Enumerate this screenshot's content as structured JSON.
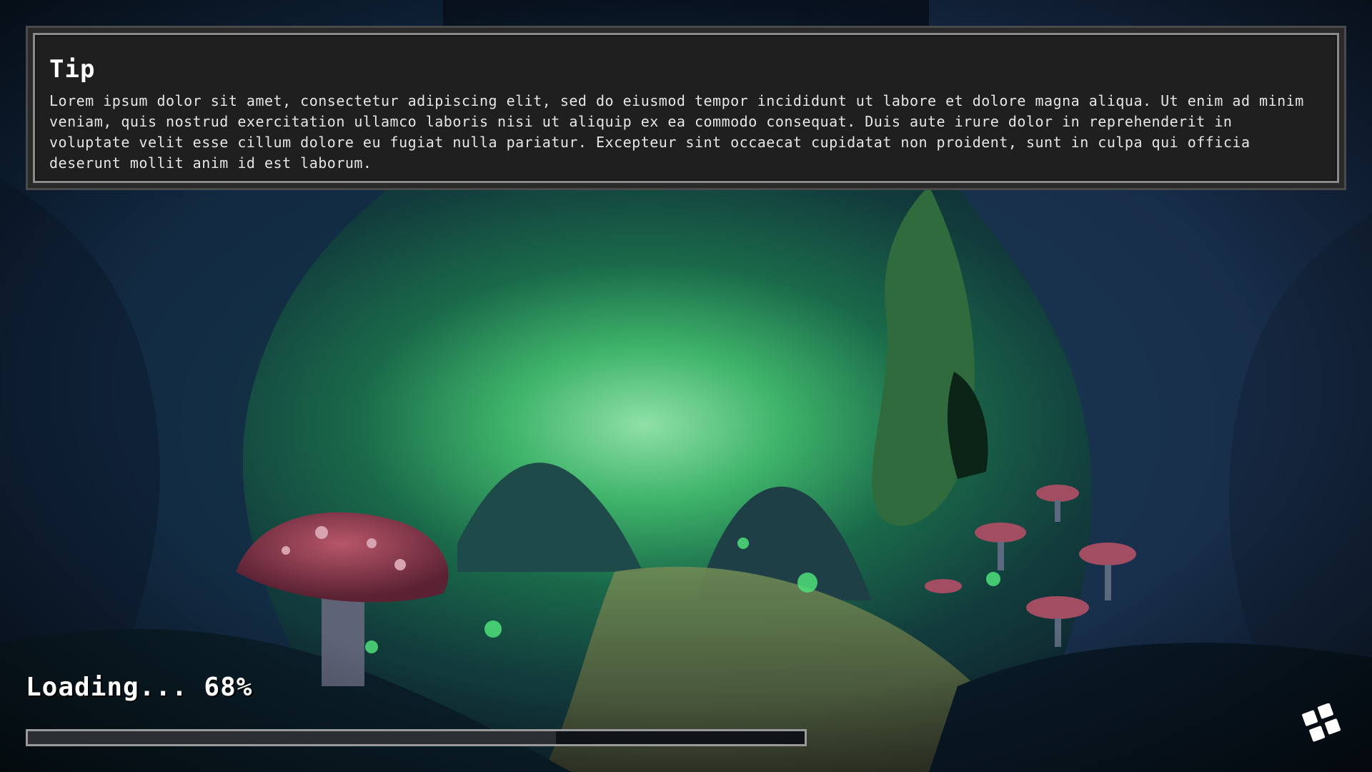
{
  "tip": {
    "title": "Tip",
    "body": "Lorem ipsum dolor sit amet, consectetur adipiscing elit, sed do eiusmod tempor incididunt ut labore et dolore magna aliqua. Ut enim ad minim veniam, quis nostrud exercitation ullamco laboris nisi ut aliquip ex ea commodo consequat. Duis aute irure dolor in reprehenderit in voluptate velit esse cillum dolore eu fugiat nulla pariatur. Excepteur sint occaecat cupidatat non proident, sunt in culpa qui officia deserunt mollit anim id est laborum."
  },
  "loading": {
    "label": "Loading... 68%",
    "progress": 0.68
  },
  "icons": {
    "spinner": "loading-spinner-icon"
  },
  "colors": {
    "panel_border": "#8a8a8a",
    "panel_bg": "#1f1f1f",
    "text": "#ffffff",
    "progress_border": "#9a9a9a"
  }
}
